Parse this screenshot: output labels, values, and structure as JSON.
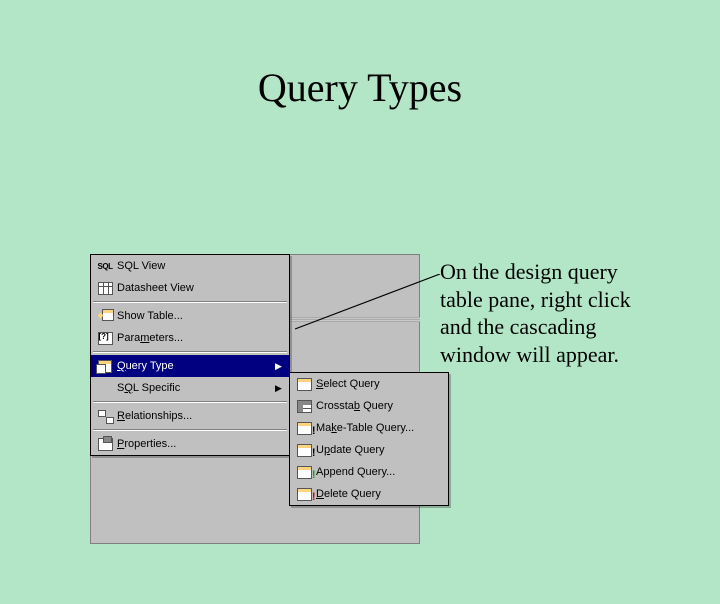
{
  "title": "Query Types",
  "annotation": "On the design query table pane, right click and the cascading window will appear.",
  "menu": {
    "sql_view": "View",
    "sql_pre": "SQL ",
    "datasheet": "heet View",
    "datasheet_pre": "Datas",
    "show_table": "able...",
    "show_table_pre": "Show T",
    "parameters": "eters...",
    "parameters_pre": "Para",
    "params_u": "m",
    "query_type": "uery Type",
    "query_type_pre": "",
    "query_u": "Q",
    "sql_specific": "L Specific",
    "sql_u": "Q",
    "sql_pre2": "S",
    "relationships": "elationships...",
    "rel_u": "R",
    "properties": "roperties...",
    "prop_u": "P"
  },
  "submenu": {
    "select": "elect Query",
    "select_u": "S",
    "crosstab": " Query",
    "crosstab_pre": "Crossta",
    "crosstab_u": "b",
    "make_table": "e-Table Query...",
    "make_pre": "Ma",
    "make_u": "k",
    "update": "date Query",
    "update_pre": "U",
    "update_u": "p",
    "append": "end Query...",
    "append_pre": "App",
    "append_u": "",
    "delete": "elete Query",
    "delete_u": "D"
  }
}
